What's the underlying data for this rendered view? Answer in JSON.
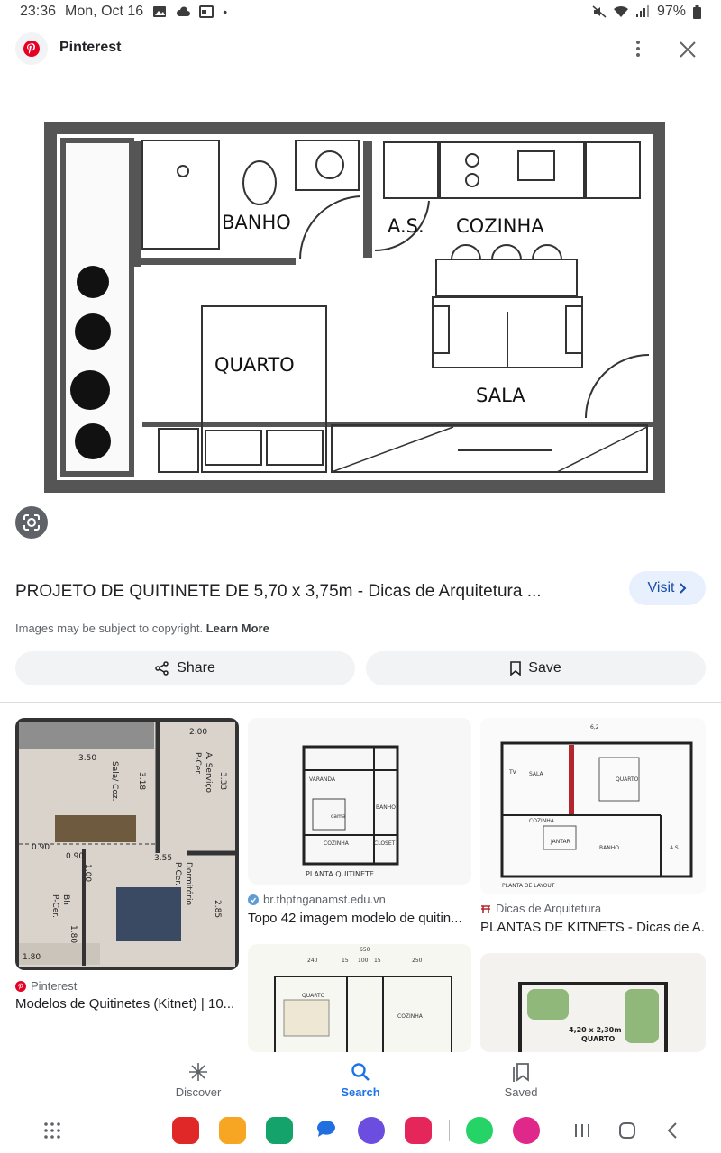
{
  "status_bar": {
    "time": "23:36",
    "date": "Mon, Oct 16",
    "battery": "97%",
    "icons_left": [
      "image-icon",
      "cloud-icon",
      "calendar-icon",
      "dot-icon"
    ],
    "icons_right": [
      "mute-icon",
      "wifi-icon",
      "signal-icon",
      "battery-icon"
    ]
  },
  "header": {
    "app_name": "Pinterest",
    "more_icon": "more-vert-icon",
    "close_icon": "close-icon"
  },
  "main_image": {
    "room_labels": [
      "BANHO",
      "A.S.",
      "COZINHA",
      "QUARTO",
      "SALA"
    ]
  },
  "result": {
    "title": "PROJETO DE QUITINETE DE 5,70 x 3,75m - Dicas de Arquitetura ...",
    "visit_label": "Visit",
    "copyright_text": "Images may be subject to copyright.",
    "learn_more": "Learn More",
    "share_label": "Share",
    "save_label": "Save"
  },
  "related": [
    {
      "source": "Pinterest",
      "title": "Modelos de Quitinetes (Kitnet) | 10...",
      "labels": [
        "2.00",
        "3.50",
        "Sala/ Coz.",
        "3.18",
        "A. Serviço",
        "P-Cer.",
        "3.33",
        "0.90",
        "0.90",
        "1.00",
        "3.55",
        "Dormitório",
        "P-Cer.",
        "2.85",
        "Bh",
        "P-Cer.",
        "1.80",
        "1.80"
      ]
    },
    {
      "source": "br.thptnganamst.edu.vn",
      "title": "Topo 42 imagem modelo de quitin...",
      "labels": [
        "PLANTA QUITINETE",
        "VARANDA",
        "BANHO",
        "COZINHA",
        "CLOSET",
        "cama"
      ]
    },
    {
      "source": "Dicas de Arquitetura",
      "title": "PLANTAS DE KITNETS - Dicas de A...",
      "labels": [
        "6,2",
        "SALA",
        "QUARTO",
        "COZINHA",
        "JANTAR",
        "BANHO",
        "A.S.",
        "PLANTA DE LAYOUT",
        "TV"
      ]
    },
    {
      "source": "",
      "title": "",
      "labels": [
        "650",
        "240",
        "15",
        "100",
        "15",
        "250",
        "QUARTO",
        "COZINHA"
      ]
    },
    {
      "source": "",
      "title": "",
      "labels": [
        "4,20 x 2,30m",
        "QUARTO"
      ]
    }
  ],
  "bottom_nav": {
    "tabs": [
      {
        "label": "Discover",
        "icon": "sparkle-icon"
      },
      {
        "label": "Search",
        "icon": "search-icon"
      },
      {
        "label": "Saved",
        "icon": "bookmarks-icon"
      }
    ]
  },
  "dock": {
    "apps": [
      "apps-grid-icon",
      "flipboard-icon",
      "folder-icon",
      "phone-icon",
      "messages-icon",
      "internet-icon",
      "camera-icon",
      "whatsapp-icon",
      "gallery-icon"
    ],
    "nav": [
      "recents-icon",
      "home-icon",
      "back-icon"
    ]
  },
  "colors": {
    "accent": "#1a73e8",
    "pinterest": "#e60023",
    "visit_bg": "#e8f0fe",
    "pill_bg": "#f1f3f4"
  }
}
